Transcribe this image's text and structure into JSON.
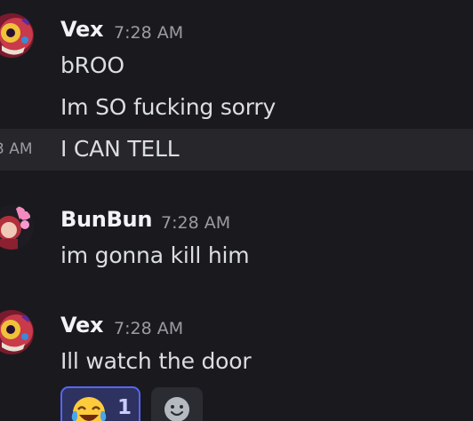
{
  "messages": [
    {
      "author": "Vex",
      "time": "7:28 AM",
      "avatar_icon": "vex-avatar",
      "lines": [
        "bROO",
        "Im SO fucking sorry",
        "I CAN TELL"
      ],
      "hover_time": "3 AM"
    },
    {
      "author": "BunBun",
      "time": "7:28 AM",
      "avatar_icon": "bunbun-avatar",
      "lines": [
        "im gonna kill him"
      ]
    },
    {
      "author": "Vex",
      "time": "7:28 AM",
      "avatar_icon": "vex-avatar",
      "lines": [
        "Ill watch the door"
      ],
      "reactions": [
        {
          "emoji": "face-with-tears-of-joy-icon",
          "count": "1",
          "active": true
        }
      ]
    }
  ],
  "colors": {
    "background": "#1a1a1e",
    "hover_row": "#26262b",
    "username": "#f2f3f5",
    "message_text": "#dbdee1",
    "timestamp": "#9b9ca3",
    "reaction_border": "#5865f2",
    "reaction_bg": "#2d3260"
  }
}
